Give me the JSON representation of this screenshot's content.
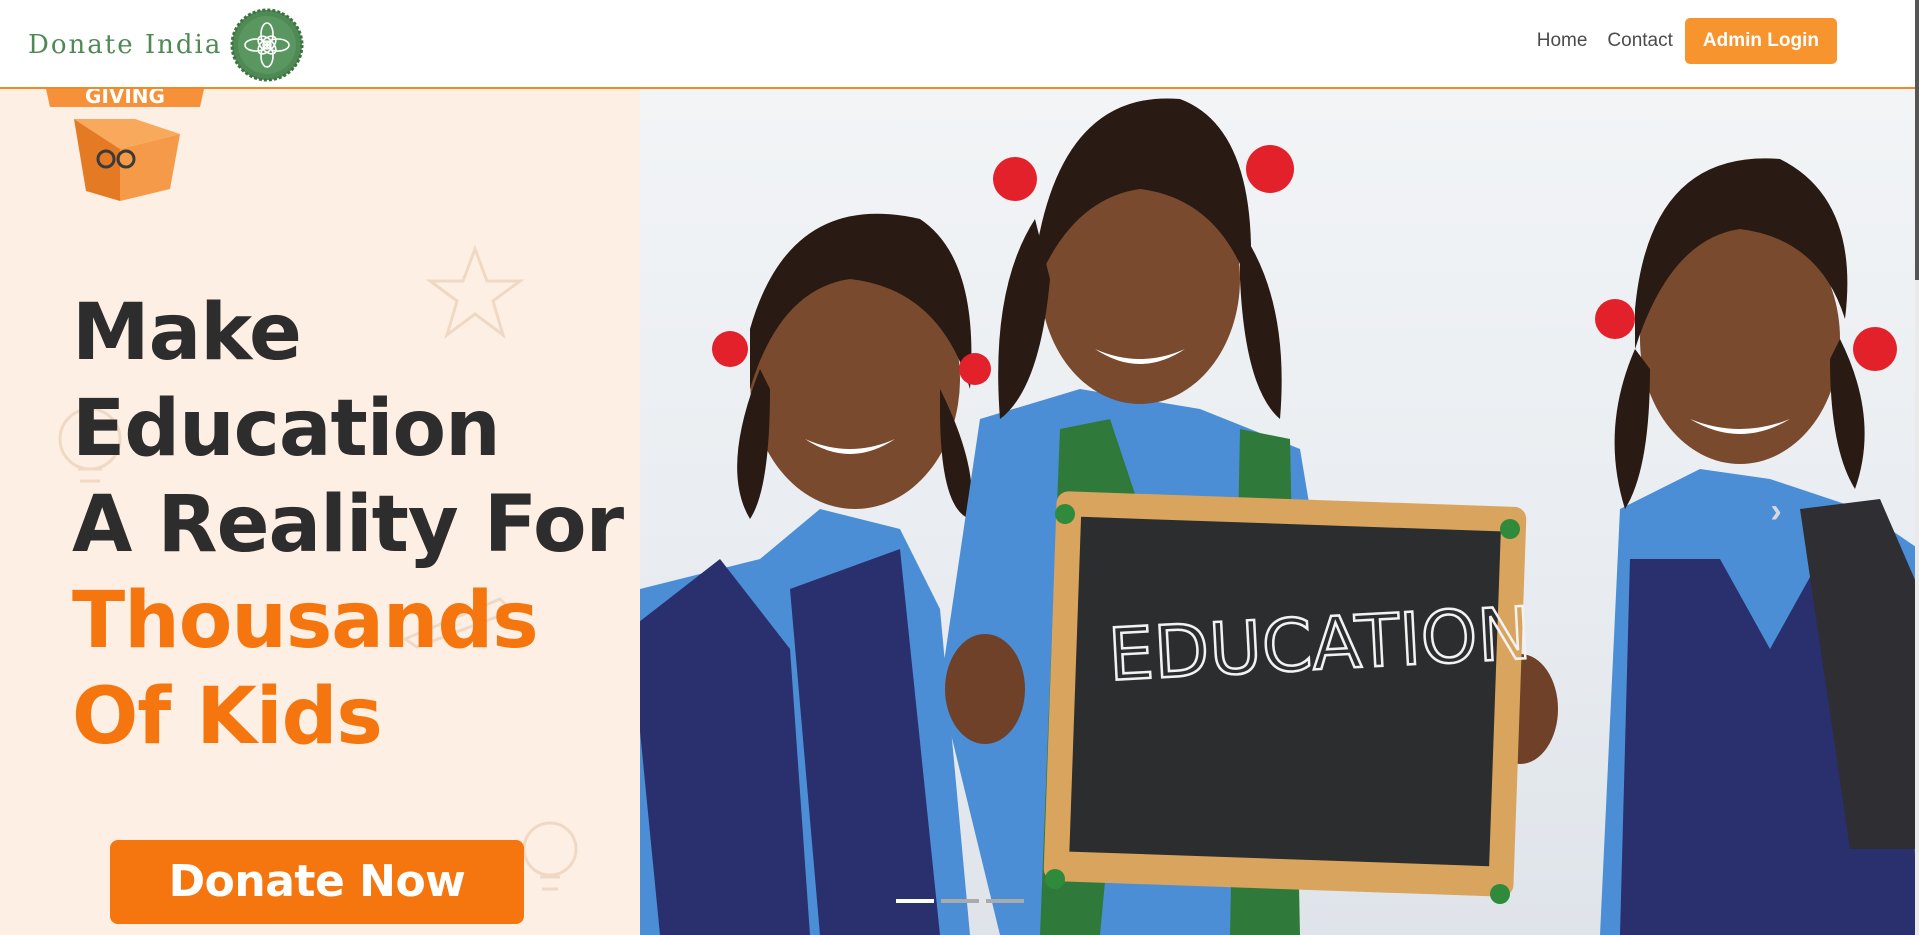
{
  "brand": {
    "name": "Donate India",
    "logo_icon": "lotus-mandala-icon",
    "logo_color": "#4f8a55"
  },
  "nav": {
    "home_label": "Home",
    "contact_label": "Contact",
    "admin_login_label": "Admin Login"
  },
  "colors": {
    "accent": "#f7942e",
    "headline_dark": "#2d2d2d",
    "headline_orange": "#f5760e",
    "left_panel_bg": "#fdefe4"
  },
  "hero": {
    "badge_text": "GIVING",
    "headline_lines": [
      "Make",
      "Education",
      "A Reality For"
    ],
    "headline_highlight_lines": [
      "Thousands",
      "Of Kids"
    ],
    "donate_label": "Donate Now",
    "chalkboard_text": "EDUCATION",
    "next_icon": "chevron-right-icon"
  },
  "carousel": {
    "slide_count": 3,
    "active_index": 0
  }
}
